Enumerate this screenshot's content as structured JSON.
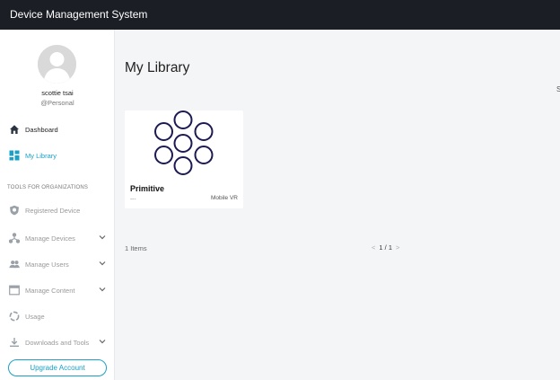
{
  "app": {
    "title": "Device Management System"
  },
  "user": {
    "name": "scottie tsai",
    "org": "@Personal"
  },
  "sidebar": {
    "nav": [
      {
        "label": "Dashboard",
        "icon": "home-icon"
      },
      {
        "label": "My Library",
        "icon": "grid-icon"
      }
    ],
    "section_label": "TOOLS FOR ORGANIZATIONS",
    "tools": [
      {
        "label": "Registered Device",
        "icon": "shield-icon"
      },
      {
        "label": "Manage Devices",
        "icon": "hierarchy-icon"
      },
      {
        "label": "Manage Users",
        "icon": "users-icon"
      },
      {
        "label": "Manage Content",
        "icon": "window-icon"
      },
      {
        "label": "Usage",
        "icon": "usage-ring-icon"
      },
      {
        "label": "Downloads and Tools",
        "icon": "download-icon"
      }
    ],
    "upgrade_label": "Upgrade Account"
  },
  "main": {
    "title": "My Library",
    "edge_text": "S",
    "cards": [
      {
        "name": "Primitive",
        "subtitle": "---",
        "type": "Mobile VR"
      }
    ],
    "items_count": "1 Items",
    "pagination": {
      "prev": "<",
      "page": "1 / 1",
      "next": ">"
    }
  },
  "colors": {
    "accent": "#1aa1c7",
    "topbar": "#1b1f25",
    "thumbnail_stroke": "#1c1a52"
  }
}
